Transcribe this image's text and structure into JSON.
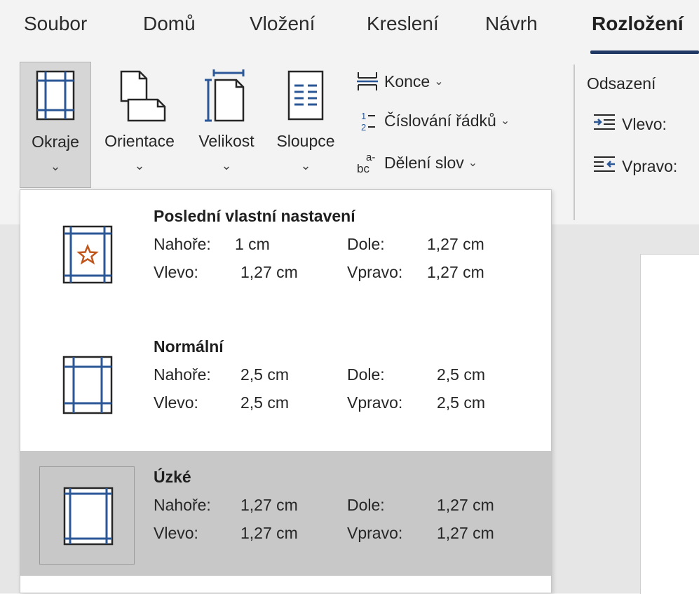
{
  "tabs": [
    {
      "label": "Soubor"
    },
    {
      "label": "Domů"
    },
    {
      "label": "Vložení"
    },
    {
      "label": "Kreslení"
    },
    {
      "label": "Návrh"
    },
    {
      "label": "Rozložení",
      "active": true
    }
  ],
  "ribbon": {
    "okraje": {
      "label": "Okraje",
      "icon": "margins-icon"
    },
    "orientace": {
      "label": "Orientace",
      "icon": "orientation-icon"
    },
    "velikost": {
      "label": "Velikost",
      "icon": "page-size-icon"
    },
    "sloupce": {
      "label": "Sloupce",
      "icon": "columns-icon"
    },
    "konce": {
      "label": "Konce",
      "icon": "breaks-icon"
    },
    "cislovani": {
      "label": "Číslování řádků",
      "icon": "line-numbers-icon"
    },
    "deleni": {
      "label": "Dělení slov",
      "icon": "hyphenation-icon"
    },
    "odsazeni": {
      "title": "Odsazení",
      "left_label": "Vlevo:",
      "right_label": "Vpravo:"
    }
  },
  "margin_presets": [
    {
      "title": "Poslední vlastní nastavení",
      "top_label": "Nahoře:",
      "top": "1 cm",
      "bottom_label": "Dole:",
      "bottom": "1,27 cm",
      "left_label": "Vlevo:",
      "left": "1,27 cm",
      "right_label": "Vpravo:",
      "right": "1,27 cm",
      "icon": "custom-margins-star-icon"
    },
    {
      "title": "Normální",
      "top_label": "Nahoře:",
      "top": "2,5 cm",
      "bottom_label": "Dole:",
      "bottom": "2,5 cm",
      "left_label": "Vlevo:",
      "left": "2,5 cm",
      "right_label": "Vpravo:",
      "right": "2,5 cm",
      "icon": "normal-margins-icon"
    },
    {
      "title": "Úzké",
      "top_label": "Nahoře:",
      "top": "1,27 cm",
      "bottom_label": "Dole:",
      "bottom": "1,27 cm",
      "left_label": "Vlevo:",
      "left": "1,27 cm",
      "right_label": "Vpravo:",
      "right": "1,27 cm",
      "icon": "narrow-margins-icon",
      "selected": true
    }
  ],
  "colors": {
    "accent": "#1f3864",
    "icon_blue": "#2b5797",
    "star": "#c0561b",
    "selected_bg": "#c8c8c8"
  }
}
